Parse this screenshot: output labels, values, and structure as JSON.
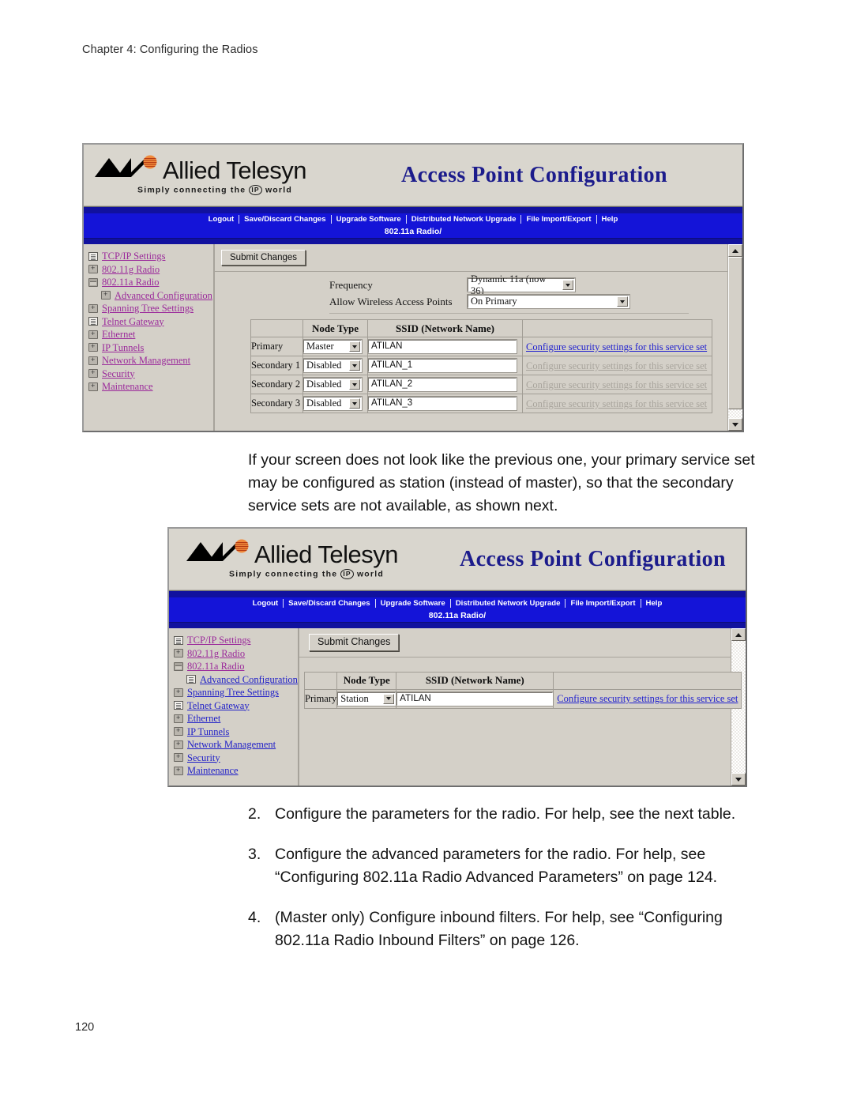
{
  "document": {
    "running_header": "Chapter 4: Configuring the Radios",
    "page_number": "120",
    "intro_paragraph": "If your screen does not look like the previous one, your primary service set may be configured as station (instead of master), so that the secondary service sets are not available, as shown next.",
    "steps": [
      {
        "marker": "2.",
        "text": "Configure the parameters for the radio. For help, see the next table."
      },
      {
        "marker": "3.",
        "text": "Configure the advanced parameters for the radio. For help, see “Configuring 802.11a Radio Advanced Parameters” on page 124."
      },
      {
        "marker": "4.",
        "text": "(Master only) Configure inbound filters. For help, see “Configuring 802.11a Radio Inbound Filters” on page 126."
      }
    ]
  },
  "brand": {
    "company": "Allied Telesyn",
    "tagline": "Simply connecting the",
    "tagline_icon": "IP",
    "tagline_end": "world",
    "app_title": "Access Point Configuration",
    "title_color": "#1c1c8c",
    "navbar_color": "#1414d8"
  },
  "navbar": {
    "items": [
      {
        "label": "Logout"
      },
      {
        "label": "Save/Discard Changes"
      },
      {
        "label": "Upgrade Software"
      },
      {
        "label": "Distributed Network Upgrade"
      },
      {
        "label": "File Import/Export"
      },
      {
        "label": "Help"
      }
    ],
    "breadcrumb": "802.11a Radio/"
  },
  "sidebar": {
    "items": [
      {
        "label": "TCP/IP Settings",
        "icon": "page-icon",
        "visited": true,
        "indent": false
      },
      {
        "label": "802.11g Radio",
        "icon": "folder-icon",
        "visited": true,
        "indent": false
      },
      {
        "label": "802.11a Radio",
        "icon": "folder-open-icon",
        "visited": true,
        "indent": false
      },
      {
        "label": "Advanced Configuration",
        "icon": "page-icon",
        "visited": false,
        "indent": true
      },
      {
        "label": "Spanning Tree Settings",
        "icon": "folder-icon",
        "visited": false,
        "indent": false
      },
      {
        "label": "Telnet Gateway",
        "icon": "page-icon",
        "visited": false,
        "indent": false
      },
      {
        "label": "Ethernet",
        "icon": "folder-icon",
        "visited": false,
        "indent": false
      },
      {
        "label": "IP Tunnels",
        "icon": "folder-icon",
        "visited": false,
        "indent": false
      },
      {
        "label": "Network Management",
        "icon": "folder-icon",
        "visited": false,
        "indent": false
      },
      {
        "label": "Security",
        "icon": "folder-icon",
        "visited": false,
        "indent": false
      },
      {
        "label": "Maintenance",
        "icon": "folder-icon",
        "visited": false,
        "indent": false
      }
    ]
  },
  "screenshot1": {
    "submit_label": "Submit Changes",
    "fields": [
      {
        "label": "Frequency",
        "value": "Dynamic 11a (now 36)"
      },
      {
        "label": "Allow Wireless Access Points",
        "value": "On Primary"
      }
    ],
    "table": {
      "headers": [
        "",
        "Node Type",
        "SSID (Network Name)",
        ""
      ],
      "rows": [
        {
          "label": "Primary",
          "node_type": "Master",
          "ssid": "ATILAN",
          "link": "Configure security settings for this service set",
          "link_enabled": true
        },
        {
          "label": "Secondary 1",
          "node_type": "Disabled",
          "ssid": "ATILAN_1",
          "link": "Configure security settings for this service set",
          "link_enabled": false
        },
        {
          "label": "Secondary 2",
          "node_type": "Disabled",
          "ssid": "ATILAN_2",
          "link": "Configure security settings for this service set",
          "link_enabled": false
        },
        {
          "label": "Secondary 3",
          "node_type": "Disabled",
          "ssid": "ATILAN_3",
          "link": "Configure security settings for this service set",
          "link_enabled": false
        }
      ]
    }
  },
  "screenshot2": {
    "submit_label": "Submit Changes",
    "table": {
      "headers": [
        "",
        "Node Type",
        "SSID (Network Name)",
        ""
      ],
      "rows": [
        {
          "label": "Primary",
          "node_type": "Station",
          "ssid": "ATILAN",
          "link": "Configure security settings for this service set",
          "link_enabled": true
        }
      ]
    }
  }
}
